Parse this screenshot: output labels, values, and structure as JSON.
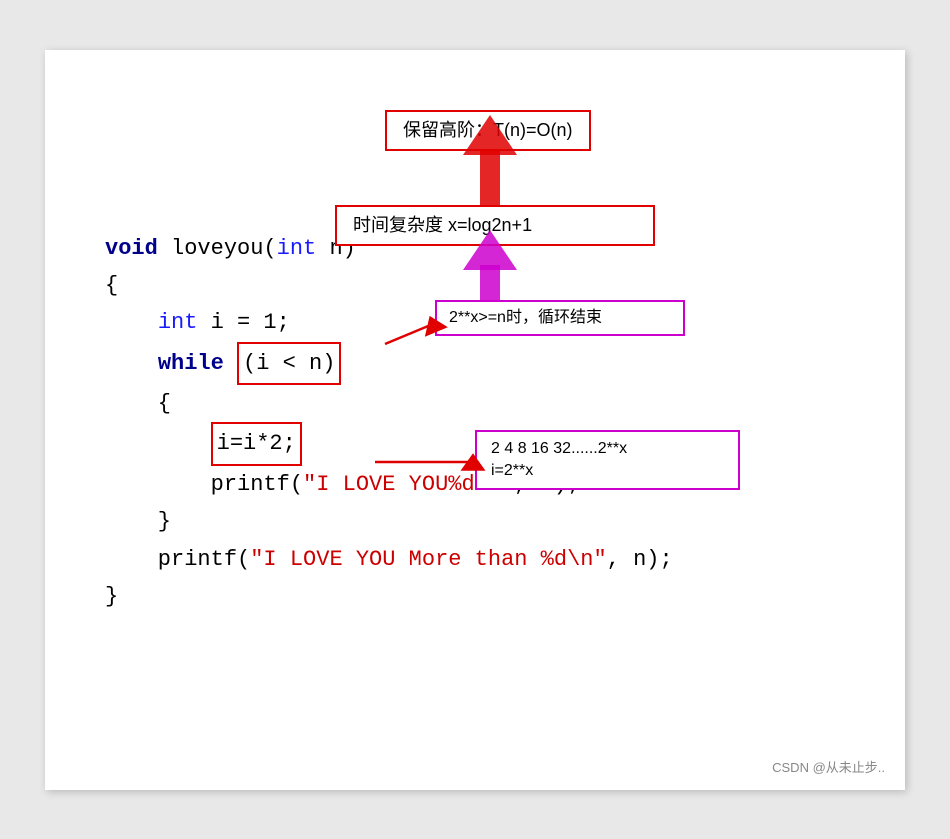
{
  "annotations": {
    "box1_label": "保留高阶：T(n)=O(n)",
    "box2_label": "时间复杂度 x=log2n+1",
    "box3_label": "2**x>=n时，循环结束",
    "box4_line1": "2 4 8 16 32......2**x",
    "box4_line2": "i=2**x",
    "watermark": "CSDN @从未止步.."
  },
  "code": {
    "line1": "void loveyou(int n)",
    "line2": "{",
    "line3": "    int i = 1;",
    "line4": "    while (i < n)",
    "line5": "    {",
    "line6": "        i=i*2;",
    "line7": "        printf(\"I LOVE YOU%d\\n\", i);",
    "line8": "    }",
    "line9": "    printf(\"I LOVE YOU More than %d\\n\", n);",
    "line10": "}"
  }
}
